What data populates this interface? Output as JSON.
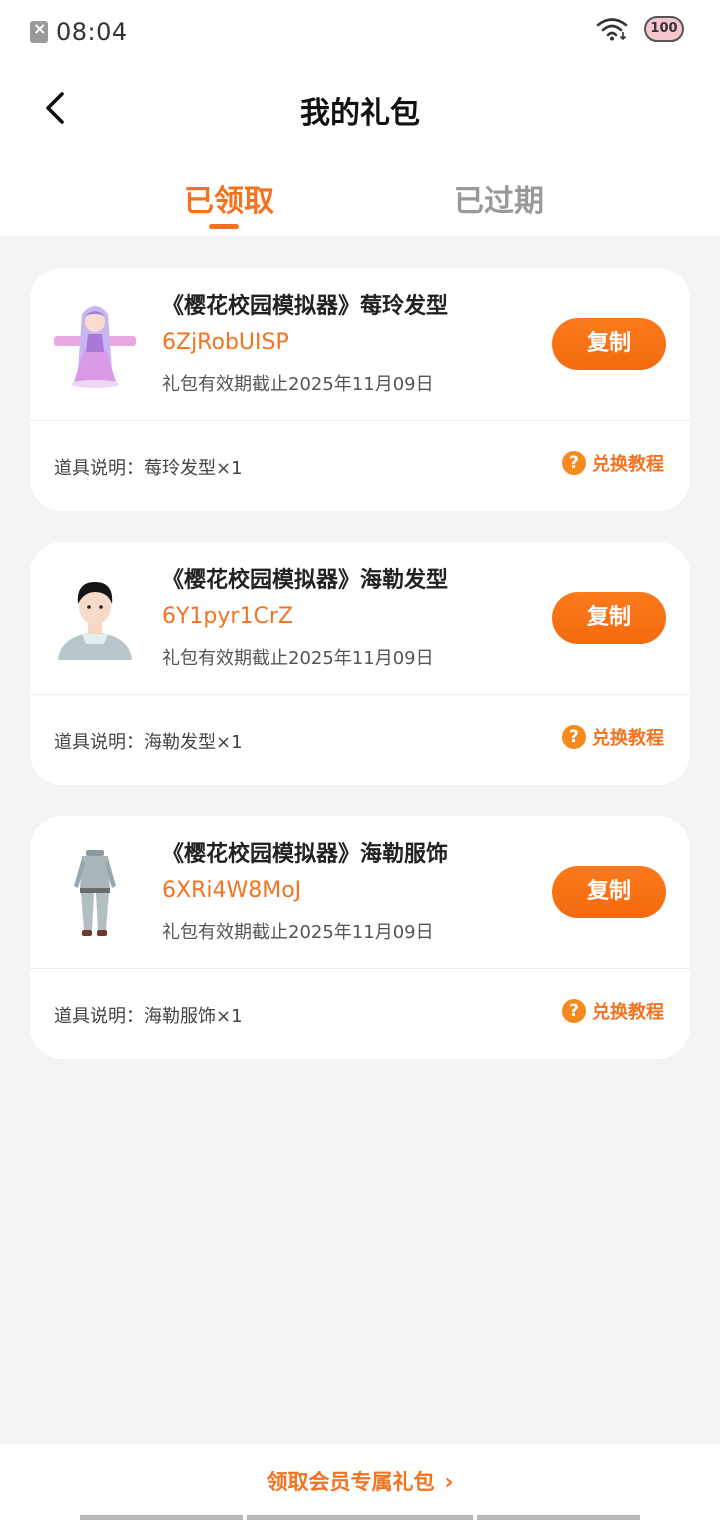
{
  "status_bar": {
    "time": "08:04",
    "battery": "100"
  },
  "header": {
    "title": "我的礼包"
  },
  "tabs": [
    {
      "label": "已领取",
      "active": true
    },
    {
      "label": "已过期",
      "active": false
    }
  ],
  "cards": [
    {
      "title": "《樱花校园模拟器》莓玲发型",
      "code": "6ZjRobUISP",
      "expire": "礼包有效期截止2025年11月09日",
      "copy_label": "复制",
      "desc": "道具说明：莓玲发型×1",
      "tutorial_label": "兑换教程",
      "image": "purple-hair-character"
    },
    {
      "title": "《樱花校园模拟器》海勒发型",
      "code": "6Y1pyr1CrZ",
      "expire": "礼包有效期截止2025年11月09日",
      "copy_label": "复制",
      "desc": "道具说明：海勒发型×1",
      "tutorial_label": "兑换教程",
      "image": "black-hair-boy"
    },
    {
      "title": "《樱花校园模拟器》海勒服饰",
      "code": "6XRi4W8MoJ",
      "expire": "礼包有效期截止2025年11月09日",
      "copy_label": "复制",
      "desc": "道具说明：海勒服饰×1",
      "tutorial_label": "兑换教程",
      "image": "grey-outfit"
    }
  ],
  "footer": {
    "vip_link": "领取会员专属礼包"
  },
  "colors": {
    "accent": "#f37320",
    "button": "#f97316",
    "background": "#f4f4f6"
  }
}
